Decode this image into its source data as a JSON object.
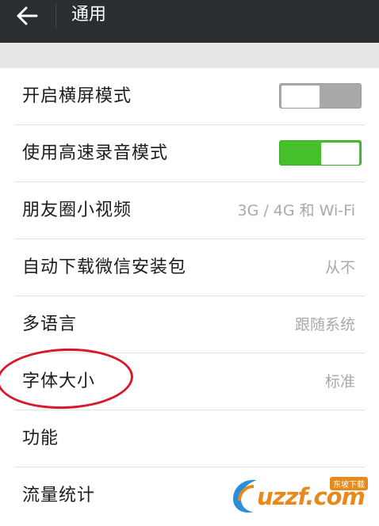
{
  "header": {
    "title": "通用",
    "back_icon": "arrow-left-icon"
  },
  "settings": [
    {
      "label": "开启横屏模式",
      "toggle": "off"
    },
    {
      "label": "使用高速录音模式",
      "toggle": "on"
    },
    {
      "label": "朋友圈小视频",
      "value": "3G / 4G 和 Wi-Fi"
    },
    {
      "label": "自动下载微信安装包",
      "value": "从不"
    },
    {
      "label": "多语言",
      "value": "跟随系统"
    },
    {
      "label": "字体大小",
      "value": "标准"
    },
    {
      "label": "功能"
    },
    {
      "label": "流量统计"
    }
  ],
  "colors": {
    "titlebar": "#2b2e31",
    "toggle_on": "#45bf2a",
    "toggle_off": "#a9aaa7",
    "annotation": "#d8182c",
    "watermark": "#e8891c"
  },
  "watermark": {
    "brand": "uzzf.com",
    "badge": "东坡下载"
  }
}
